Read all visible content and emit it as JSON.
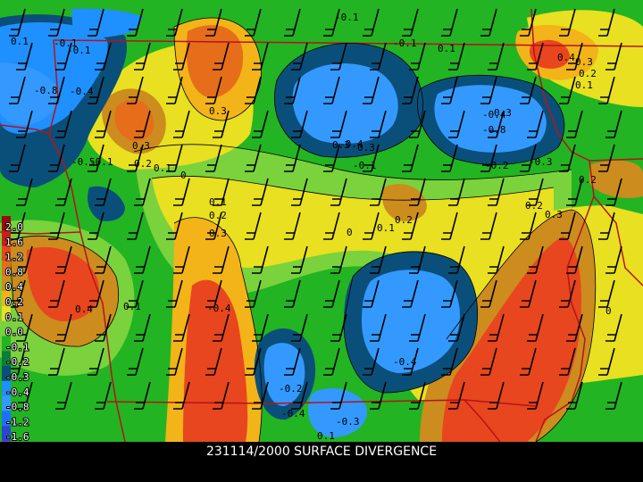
{
  "caption": "231114/2000 SURFACE DIVERGENCE",
  "colors": {
    "vneg20": "#8a2be2",
    "vneg16": "#2a46d0",
    "vneg12": "#1e6fff",
    "vneg08": "#3399ff",
    "vneg04": "#1e90ff",
    "vneg03": "#0a4f7a",
    "vneg02": "#0a7f3a",
    "vneg01": "#22b422",
    "v00": "#7ad23c",
    "v01": "#e8e020",
    "v02": "#f2b418",
    "v03": "#cc8c1e",
    "v04": "#e66e1a",
    "v06": "#e8461e",
    "v08": "#c81e1e",
    "v10": "#9a0a0a",
    "boundary": "#b8121a",
    "contour": "#000000",
    "barb": "#000000"
  },
  "legend": [
    "2.0",
    "1.6",
    "1.2",
    "0.8",
    "0.4",
    "0.2",
    "0.1",
    "0.0",
    "-0.1",
    "-0.2",
    "-0.3",
    "-0.4",
    "-0.8",
    "-1.2",
    "-1.6",
    "-2.0"
  ],
  "contour_labels": [
    "-0.1",
    "-0.1",
    "0.1",
    "-0.1",
    "-0.1",
    "0.1",
    "0.4",
    "0.3",
    "0.2",
    "0.1",
    "-0.8",
    "-0.4",
    "0.3",
    "-0.4",
    "0.3",
    "-0.8",
    "0.3",
    "0.2",
    "0.1",
    "-0.5",
    "-0.1",
    "-0.1",
    "-0.2",
    "-0.3",
    "0.2",
    "0",
    "0.1",
    "0.2",
    "0.3",
    "0.2",
    "0.3",
    "0",
    "0.1",
    "0.2",
    "0.3",
    "-0.4",
    "0.3",
    "0.1",
    "0.4",
    "-0.4",
    "-0.4",
    "-0.2",
    "-0.4",
    "-0.3",
    "0.1",
    "0"
  ]
}
